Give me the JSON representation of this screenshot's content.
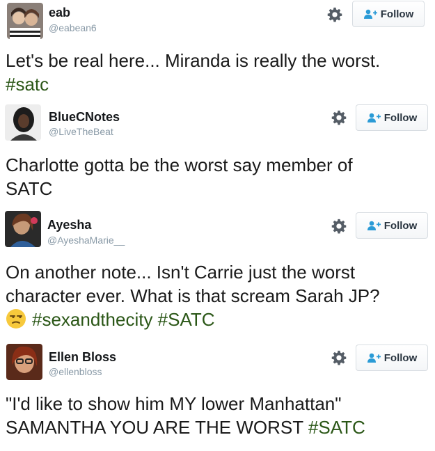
{
  "tweets": [
    {
      "name": "eab",
      "handle": "@eabean6",
      "follow_label": "Follow",
      "text": "Let's be real here... Miranda is really the worst.",
      "hashtags": "#satc"
    },
    {
      "name": "BlueCNotes",
      "handle": "@LiveTheBeat",
      "follow_label": "Follow",
      "text": "Charlotte gotta be the worst say member of SATC"
    },
    {
      "name": "Ayesha",
      "handle": "@AyeshaMarie__",
      "follow_label": "Follow",
      "text": "On another note... Isn't Carrie just the worst character ever. What is that scream Sarah JP?",
      "emoji": "unamused-face",
      "hashtags": "#sexandthecity #SATC"
    },
    {
      "name": "Ellen Bloss",
      "handle": "@ellenbloss",
      "follow_label": "Follow",
      "text": "\"I'd like to show him MY lower Manhattan\" SAMANTHA YOU ARE THE WORST",
      "hashtags": "#SATC"
    }
  ],
  "colors": {
    "hashtag": "#2b5717",
    "handle": "#8899a6",
    "follow_icon": "#2b9bd6"
  }
}
